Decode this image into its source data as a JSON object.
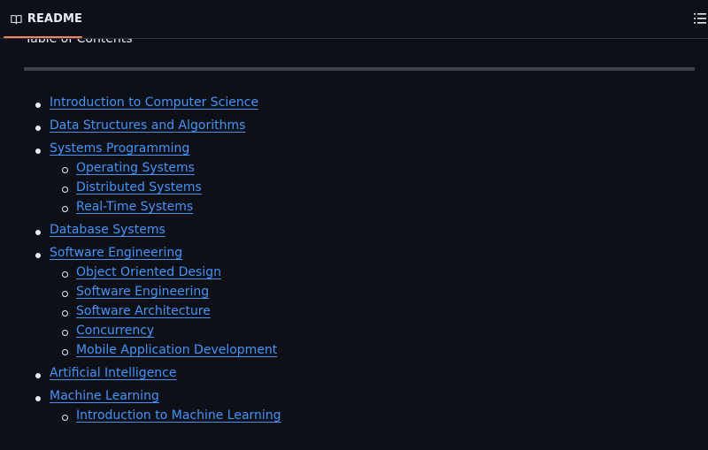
{
  "tab": {
    "label": "README",
    "icon": "book-icon"
  },
  "outline_icon": "list-outline-icon",
  "accent_color": "#f78166",
  "link_color": "#4493f8",
  "heading": "Table of Contents",
  "toc": [
    {
      "label": "Introduction to Computer Science",
      "children": []
    },
    {
      "label": "Data Structures and Algorithms",
      "children": []
    },
    {
      "label": "Systems Programming",
      "children": [
        {
          "label": "Operating Systems"
        },
        {
          "label": "Distributed Systems"
        },
        {
          "label": "Real-Time Systems"
        }
      ]
    },
    {
      "label": "Database Systems",
      "children": []
    },
    {
      "label": "Software Engineering",
      "children": [
        {
          "label": "Object Oriented Design"
        },
        {
          "label": "Software Engineering"
        },
        {
          "label": "Software Architecture"
        },
        {
          "label": "Concurrency"
        },
        {
          "label": "Mobile Application Development"
        }
      ]
    },
    {
      "label": "Artificial Intelligence",
      "children": []
    },
    {
      "label": "Machine Learning",
      "children": [
        {
          "label": "Introduction to Machine Learning"
        }
      ]
    }
  ]
}
